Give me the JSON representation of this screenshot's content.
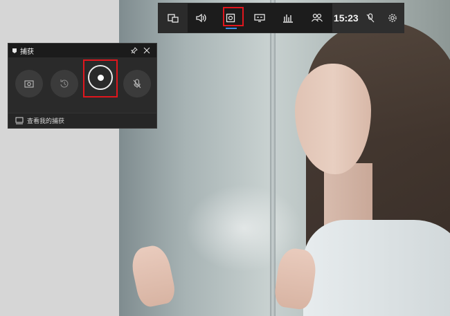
{
  "topbar": {
    "buttons": [
      {
        "name": "widget-menu",
        "icon": "widget-menu-icon"
      },
      {
        "name": "audio",
        "icon": "speaker-icon"
      },
      {
        "name": "capture",
        "icon": "capture-icon",
        "active": true,
        "highlighted": true
      },
      {
        "name": "performance",
        "icon": "performance-icon"
      },
      {
        "name": "resources",
        "icon": "bar-chart-icon"
      },
      {
        "name": "social",
        "icon": "people-icon"
      }
    ],
    "clock": "15:23",
    "mic_icon": "mic-off-icon",
    "settings_icon": "gear-icon"
  },
  "capture_widget": {
    "title": "捕获",
    "pin_icon": "pin-icon",
    "close_icon": "close-icon",
    "screenshot_icon": "camera-icon",
    "record_last_icon": "history-icon",
    "record_icon": "record-icon",
    "record_highlighted": true,
    "mic_icon": "mic-off-icon",
    "show_all_captures": "查看我的捕获"
  },
  "colors": {
    "highlight": "#e1161d",
    "active_indicator": "#3a8ee6",
    "toolbar_bg": "#1c1c1c",
    "widget_bg": "#2a2a2a"
  }
}
